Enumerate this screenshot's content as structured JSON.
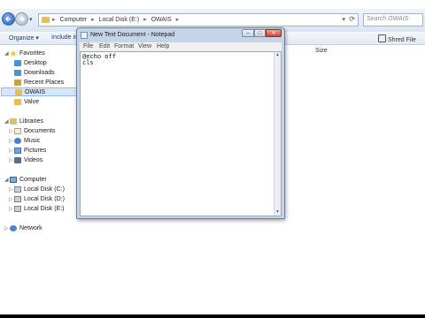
{
  "explorer": {
    "breadcrumbs": [
      "Computer",
      "Local Disk (E:)",
      "OWAIS"
    ],
    "search_placeholder": "Search OWAIS",
    "toolbar": {
      "organize": "Organize",
      "include": "Include in",
      "shred": "Shred File"
    },
    "columns": {
      "size": "Size"
    },
    "nav": {
      "favorites": "Favorites",
      "favorites_items": [
        "Desktop",
        "Downloads",
        "Recent Places",
        "OWAIS",
        "Valve"
      ],
      "libraries": "Libraries",
      "libraries_items": [
        "Documents",
        "Music",
        "Pictures",
        "Videos"
      ],
      "computer": "Computer",
      "computer_items": [
        "Local Disk (C:)",
        "Local Disk (D:)",
        "Local Disk (E:)"
      ],
      "network": "Network"
    }
  },
  "notepad": {
    "title": "New Text Document - Notepad",
    "menu": [
      "File",
      "Edit",
      "Format",
      "View",
      "Help"
    ],
    "content": "@echo off\ncls"
  },
  "colors": {
    "accent": "#245db4",
    "notepad_frame": "#c5d4e8",
    "close_button": "#c9453a",
    "selection": "#d6e5f7"
  },
  "icons": {
    "back": "back-arrow-icon",
    "forward": "forward-arrow-icon",
    "refresh": "refresh-icon",
    "folder": "folder-icon"
  }
}
